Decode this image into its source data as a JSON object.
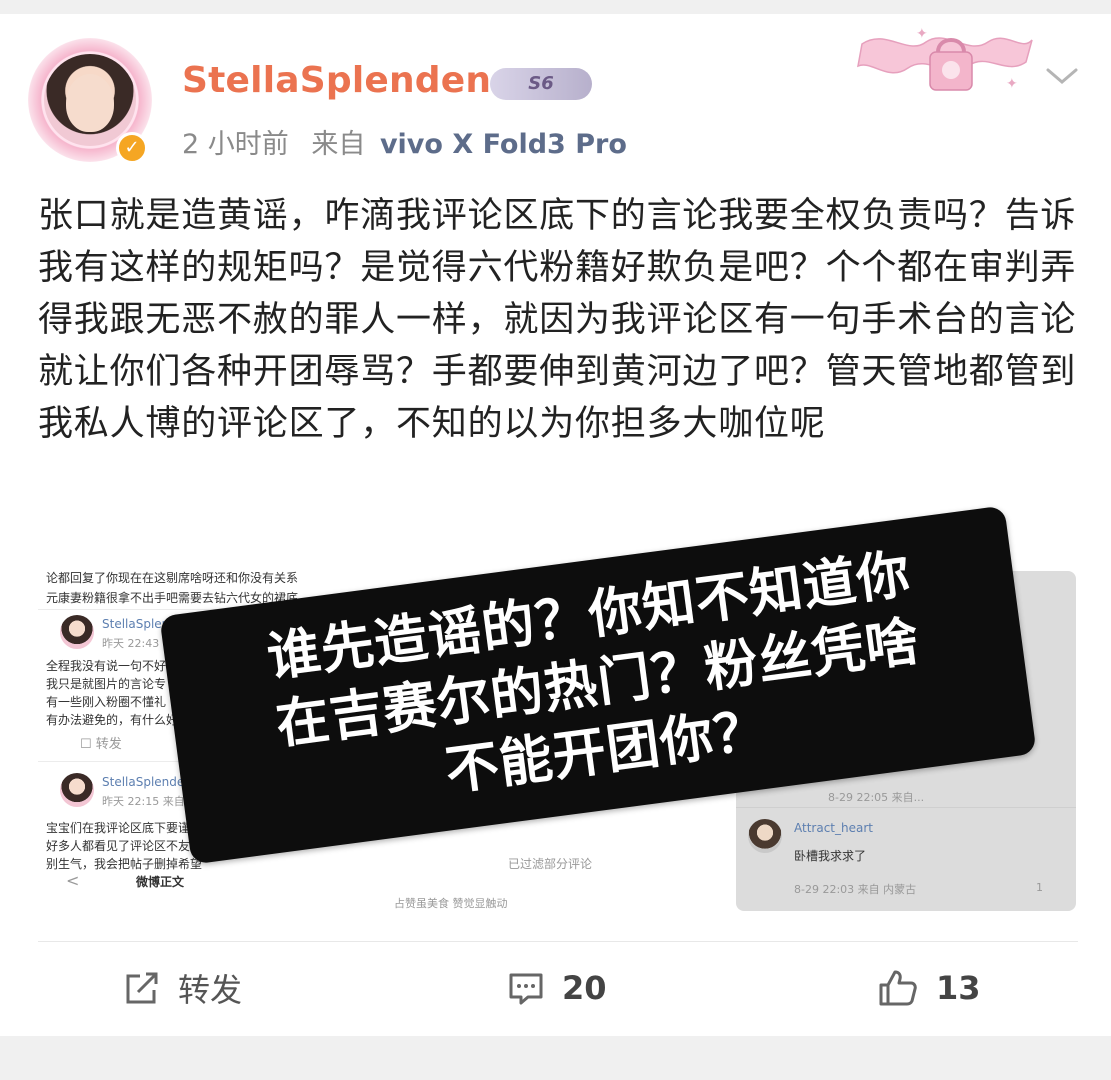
{
  "post": {
    "username": "StellaSplendens",
    "badge": "S6",
    "time": "2 小时前",
    "source_prefix": "来自",
    "source_device": "vivo X Fold3 Pro",
    "text": "张口就是造黄谣，咋滴我评论区底下的言论我要全权负责吗？告诉我有这样的规矩吗？是觉得六代粉籍好欺负是吧？个个都在审判弄得我跟无恶不赦的罪人一样，就因为我评论区有一句手术台的言论就让你们各种开团辱骂？手都要伸到黄河边了吧？管天管地都管到我私人博的评论区了，不知的以为你担多大咖位呢"
  },
  "screenshot": {
    "line1": "论都回复了你现在在这剔席啥呀还和你没有关系",
    "line2": "元康妻粉籍很拿不出手吧需要去钻六代女的裙底",
    "c1_name": "StellaSplendens",
    "c1_time": "昨天 22:43",
    "c1_l1": "全程我没有说一句不好",
    "c1_l2": "我只是就图片的言论专",
    "c1_l3": "有一些刚入粉圈不懂礼",
    "c1_l4": "有办法避免的，有什么好",
    "c1_repost": "转发",
    "c2_name": "StellaSplenden",
    "c2_time": "昨天 22:15  来自 vi",
    "c2_l1": "宝宝们在我评论区底下要谨",
    "c2_l2": "好多人都看见了评论区不友好",
    "c2_l3": "别生气，我会把帖子删掉希望",
    "nav_back": "<",
    "nav_title": "微博正文",
    "filtered": "已过滤部分评论",
    "footer": "占赞虽美食    赞觉显触动",
    "r_time1": "8-29 22:05  来自...",
    "r_name": "Attract_heart",
    "r_text": "卧槽我求求了",
    "r_time2": "8-29 22:03  来自 内蒙古",
    "r_like_count": "1"
  },
  "overlay": {
    "line1": "谁先造谣的？你知不知道你",
    "line2": "在吉赛尔的热门？粉丝凭啥",
    "line3": "不能开团你？"
  },
  "actions": {
    "repost_label": "转发",
    "comment_count": "20",
    "like_count": "13"
  },
  "colors": {
    "username": "#eb7350",
    "device": "#5d6c8a",
    "verified": "#f5a623"
  },
  "icons": [
    "verified-icon",
    "chevron-down-icon",
    "repost-icon",
    "comment-icon",
    "like-icon"
  ]
}
